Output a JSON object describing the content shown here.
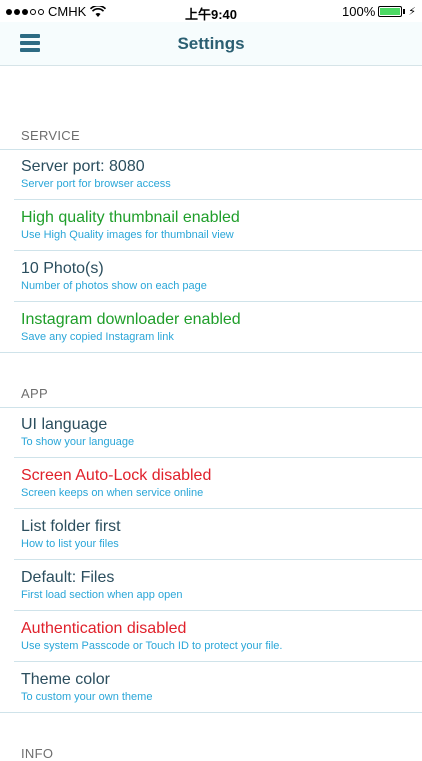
{
  "status_bar": {
    "carrier": "CMHK",
    "time": "上午9:40",
    "battery": "100%",
    "battery_level": 1.0
  },
  "navbar": {
    "title": "Settings",
    "menu_icon": "hamburger-menu-icon"
  },
  "sections": [
    {
      "header": "SERVICE",
      "rows": [
        {
          "title": "Server port: 8080",
          "subtitle": "Server port for browser access",
          "color": "default"
        },
        {
          "title": "High quality thumbnail enabled",
          "subtitle": "Use High Quality images for thumbnail view",
          "color": "green"
        },
        {
          "title": "10 Photo(s)",
          "subtitle": "Number of photos show on each page",
          "color": "default"
        },
        {
          "title": "Instagram downloader enabled",
          "subtitle": "Save any copied Instagram link",
          "color": "green"
        }
      ]
    },
    {
      "header": "APP",
      "rows": [
        {
          "title": "UI language",
          "subtitle": "To show your language",
          "color": "default"
        },
        {
          "title": "Screen Auto-Lock disabled",
          "subtitle": "Screen keeps on when service online",
          "color": "red"
        },
        {
          "title": "List folder first",
          "subtitle": "How to list your files",
          "color": "default"
        },
        {
          "title": "Default: Files",
          "subtitle": "First load section when app open",
          "color": "default"
        },
        {
          "title": "Authentication disabled",
          "subtitle": "Use system Passcode or Touch ID to protect your file.",
          "color": "red"
        },
        {
          "title": "Theme color",
          "subtitle": "To custom your own theme",
          "color": "default"
        }
      ]
    },
    {
      "header": "INFO",
      "rows": []
    }
  ],
  "colors": {
    "nav_title": "#2b5f72",
    "row_title": "#2b4e5e",
    "subtitle": "#2aa6d8",
    "enabled": "#1f9e2a",
    "disabled": "#e0212b"
  }
}
